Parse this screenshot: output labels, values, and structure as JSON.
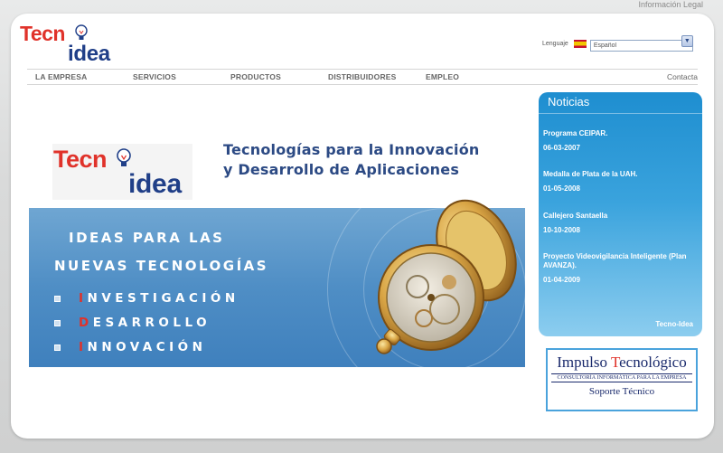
{
  "top": {
    "legal_link": "Información Legal"
  },
  "logo": {
    "part1": "Tecn",
    "part2": "idea"
  },
  "language": {
    "label": "Lenguaje",
    "selected": "Español"
  },
  "nav": {
    "items": [
      "LA EMPRESA",
      "SERVICIOS",
      "PRODUCTOS",
      "DISTRIBUIDORES",
      "EMPLEO"
    ],
    "contact": "Contacta"
  },
  "banner": {
    "logo_part1": "Tecn",
    "logo_part2": "idea",
    "title_line1": "Tecnologías para la Innovación",
    "title_line2": "y Desarrollo de Aplicaciones",
    "heading_line1": "IDEAS PARA LAS",
    "heading_line2": "NUEVAS TECNOLOGÍAS",
    "list": [
      {
        "initial": "I",
        "rest": "NVESTIGACIÓN"
      },
      {
        "initial": "D",
        "rest": "ESARROLLO"
      },
      {
        "initial": "I",
        "rest": "NNOVACIÓN"
      }
    ]
  },
  "news": {
    "heading": "Noticias",
    "entries": [
      {
        "title": "Programa CEIPAR.",
        "date": "06-03-2007"
      },
      {
        "title": "Medalla de Plata de la UAH.",
        "date": "01-05-2008"
      },
      {
        "title": "Callejero Santaella",
        "date": "10-10-2008"
      },
      {
        "title": "Proyecto Videovigilancia Inteligente (Plan AVANZA).",
        "date": "01-04-2009"
      }
    ],
    "footer": "Tecno-Idea"
  },
  "impulso": {
    "title_part1": "Impulso ",
    "title_part2_initial": "T",
    "title_part3": "ecnológico",
    "subtitle": "CONSULTORÍA INFORMÁTICA PARA LA EMPRESA",
    "support": "Soporte Técnico"
  },
  "colors": {
    "brand_red": "#e0322a",
    "brand_blue": "#203f88",
    "news_blue": "#1e8ed0",
    "banner_blue": "#4f8ec5"
  }
}
